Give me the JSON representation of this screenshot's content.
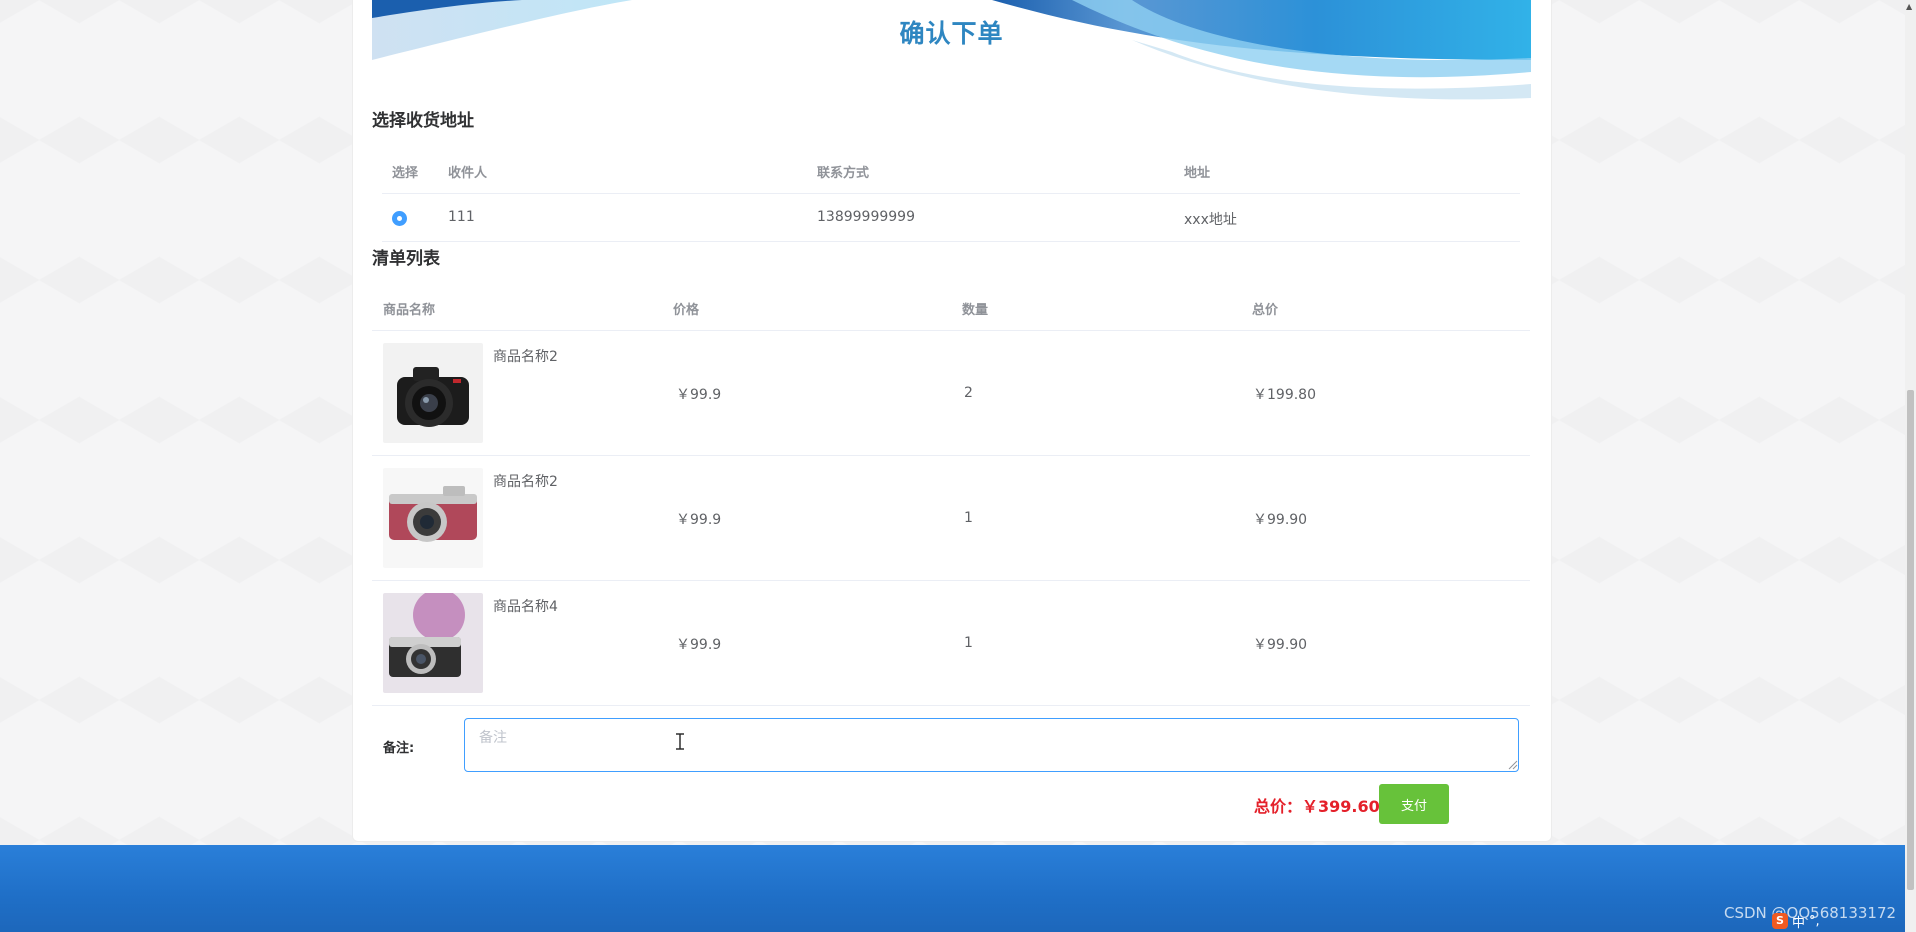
{
  "page": {
    "title": "确认下单"
  },
  "address_section": {
    "title": "选择收货地址",
    "columns": [
      "选择",
      "收件人",
      "联系方式",
      "地址"
    ],
    "rows": [
      {
        "selected": true,
        "receiver": "111",
        "phone": "13899999999",
        "address": "xxx地址"
      }
    ]
  },
  "items_section": {
    "title": "清单列表",
    "columns": [
      "商品名称",
      "价格",
      "数量",
      "总价"
    ],
    "rows": [
      {
        "name": "商品名称2",
        "price": "￥99.9",
        "quantity": "2",
        "total": "￥199.80",
        "image": "black-dslr-camera"
      },
      {
        "name": "商品名称2",
        "price": "￥99.9",
        "quantity": "1",
        "total": "￥99.90",
        "image": "red-mirrorless-camera"
      },
      {
        "name": "商品名称4",
        "price": "￥99.9",
        "quantity": "1",
        "total": "￥99.90",
        "image": "silver-mirrorless-camera"
      }
    ]
  },
  "remark": {
    "label": "备注:",
    "placeholder": "备注",
    "value": ""
  },
  "summary": {
    "total_label": "总价:",
    "total_value": "￥399.60",
    "total_text": "总价：￥399.60",
    "pay_label": "支付"
  },
  "colors": {
    "accent": "#409eff",
    "pay": "#67c23a",
    "total": "#e4202a",
    "footer": "#1f6fc7",
    "title": "#2e86c1"
  },
  "watermark": "CSDN @QQ568133172",
  "tray": {
    "ime": "中",
    "punct": "°,"
  }
}
